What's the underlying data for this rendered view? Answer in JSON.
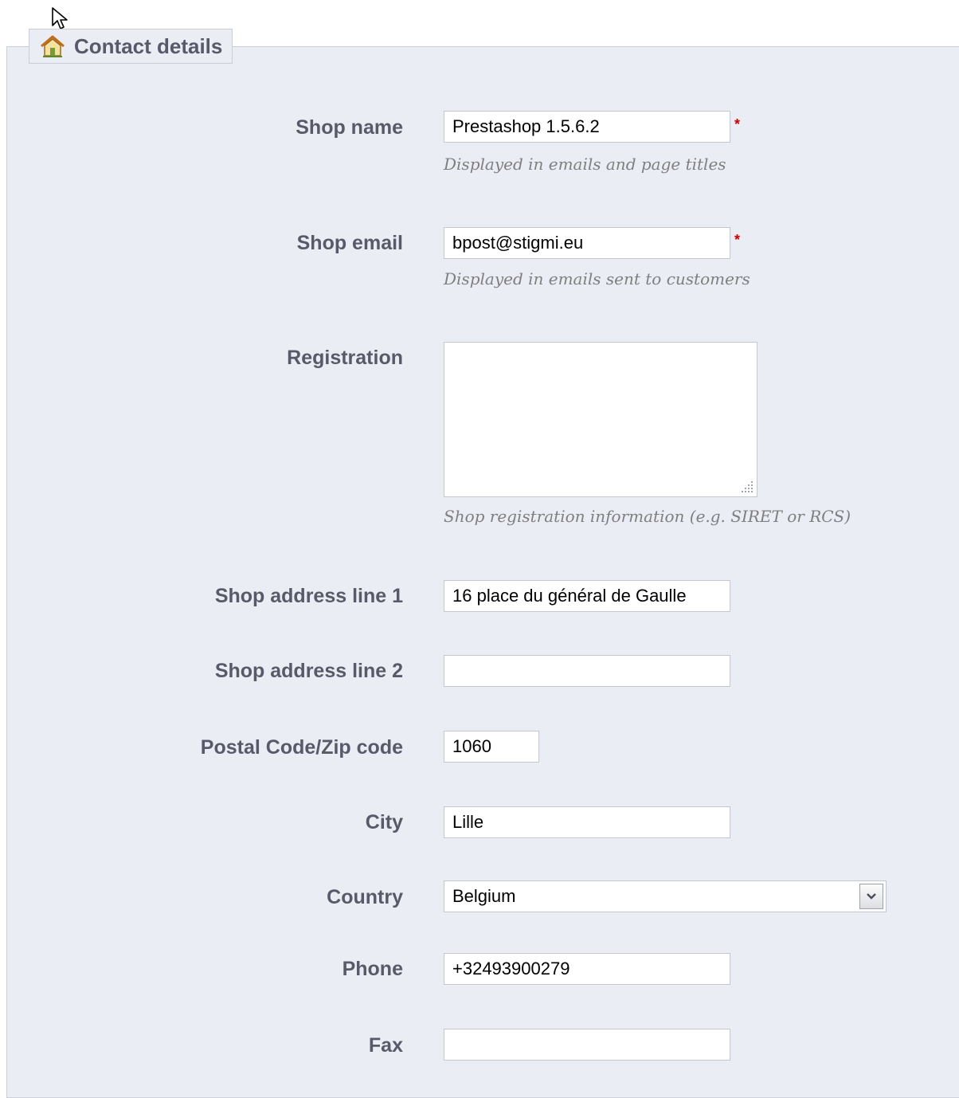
{
  "section": {
    "title": "Contact details",
    "icon": "house-icon"
  },
  "fields": {
    "shop_name": {
      "label": "Shop name",
      "value": "Prestashop 1.5.6.2",
      "required_mark": "*",
      "hint": "Displayed in emails and page titles"
    },
    "shop_email": {
      "label": "Shop email",
      "value": "bpost@stigmi.eu",
      "required_mark": "*",
      "hint": "Displayed in emails sent to customers"
    },
    "registration": {
      "label": "Registration",
      "value": "",
      "hint": "Shop registration information (e.g. SIRET or RCS)"
    },
    "address1": {
      "label": "Shop address line 1",
      "value": "16 place du général de Gaulle"
    },
    "address2": {
      "label": "Shop address line 2",
      "value": ""
    },
    "postal_code": {
      "label": "Postal Code/Zip code",
      "value": "1060"
    },
    "city": {
      "label": "City",
      "value": "Lille"
    },
    "country": {
      "label": "Country",
      "selected": "Belgium"
    },
    "phone": {
      "label": "Phone",
      "value": "+32493900279"
    },
    "fax": {
      "label": "Fax",
      "value": ""
    }
  },
  "colors": {
    "panel_bg": "#ebedf4",
    "label_text": "#585a69",
    "required": "#cc0000",
    "hint_text": "#7f7f7f"
  }
}
